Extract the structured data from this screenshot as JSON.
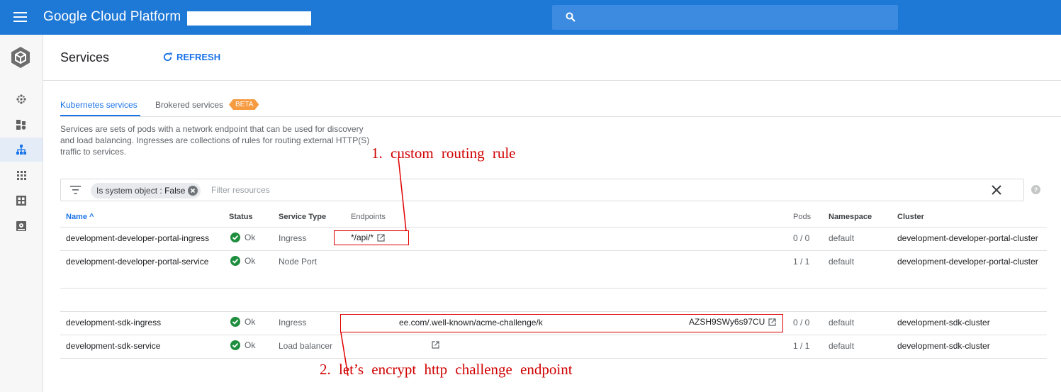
{
  "topbar": {
    "brand": "Google Cloud Platform",
    "bg_color": "#1e78d6",
    "menu_icon": "hamburger-menu-icon",
    "search_icon": "search-icon"
  },
  "rail": {
    "logo_icon": "kubernetes-engine-icon",
    "items": [
      {
        "icon": "clusters-icon"
      },
      {
        "icon": "workloads-icon"
      },
      {
        "icon": "services-icon",
        "active": true
      },
      {
        "icon": "applications-icon"
      },
      {
        "icon": "configuration-icon"
      },
      {
        "icon": "storage-icon"
      }
    ]
  },
  "header": {
    "title": "Services",
    "refresh_label": "REFRESH"
  },
  "tabs": [
    {
      "label": "Kubernetes services",
      "active": true
    },
    {
      "label": "Brokered services",
      "badge": "BETA"
    }
  ],
  "description": "Services are sets of pods with a network endpoint that can be used for discovery and load balancing. Ingresses are collections of rules for routing external HTTP(S) traffic to services.",
  "filter": {
    "chip_key": "Is system object",
    "chip_sep": ":",
    "chip_value": "False",
    "placeholder": "Filter resources"
  },
  "table": {
    "columns": [
      "Name",
      "Status",
      "Service Type",
      "Endpoints",
      "Pods",
      "Namespace",
      "Cluster"
    ],
    "sort_indicator": "^",
    "rows": [
      {
        "name": "development-developer-portal-ingress",
        "status": "Ok",
        "type": "Ingress",
        "endpoint": "*/api/*",
        "pods": "0 / 0",
        "namespace": "default",
        "cluster": "development-developer-portal-cluster"
      },
      {
        "name": "development-developer-portal-service",
        "status": "Ok",
        "type": "Node Port",
        "endpoint": "",
        "pods": "1 / 1",
        "namespace": "default",
        "cluster": "development-developer-portal-cluster"
      },
      {
        "name": "development-sdk-ingress",
        "status": "Ok",
        "type": "Ingress",
        "endpoint_part1": "ee.com/.well-known/acme-challenge/k",
        "endpoint_part2": "AZSH9SWy6s97CU",
        "pods": "0 / 0",
        "namespace": "default",
        "cluster": "development-sdk-cluster"
      },
      {
        "name": "development-sdk-service",
        "status": "Ok",
        "type": "Load balancer",
        "endpoint": "",
        "pods": "1 / 1",
        "namespace": "default",
        "cluster": "development-sdk-cluster"
      }
    ]
  },
  "annotations": {
    "one": "1.  custom  routing  rule",
    "two": "2.  let’s  encrypt  http  challenge  endpoint",
    "color": "#d00000"
  }
}
